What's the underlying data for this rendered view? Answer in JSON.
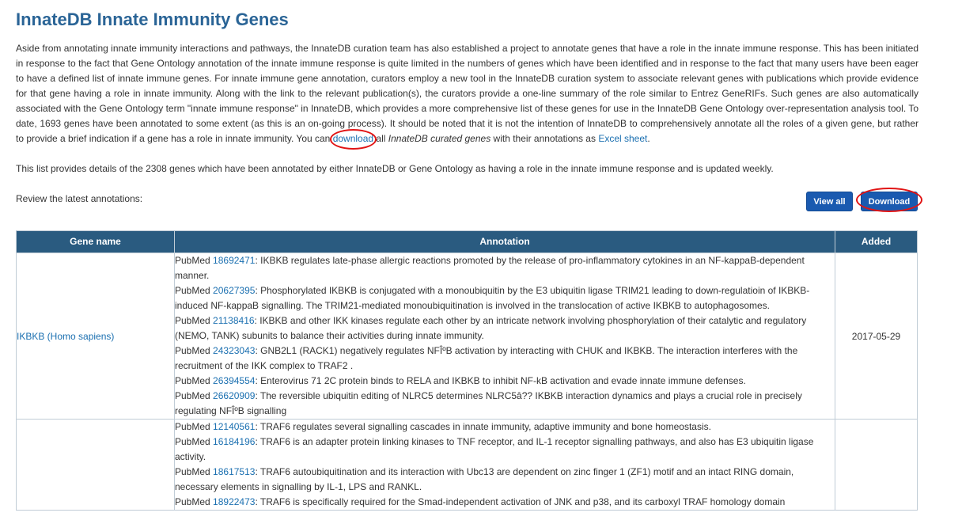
{
  "page": {
    "title": "InnateDB Innate Immunity Genes",
    "intro_before_download": "Aside from annotating innate immunity interactions and pathways, the InnateDB curation team has also established a project to annotate genes that have a role in the innate immune response. This has been initiated in response to the fact that Gene Ontology annotation of the innate immune response is quite limited in the numbers of genes which have been identified and in response to the fact that many users have been eager to have a defined list of innate immune genes. For innate immune gene annotation, curators employ a new tool in the InnateDB curation system to associate relevant genes with publications which provide evidence for that gene having a role in innate immunity. Along with the link to the relevant publication(s), the curators provide a one-line summary of the role similar to Entrez GeneRIFs. Such genes are also automatically associated with the Gene Ontology term \"innate immune response\" in InnateDB, which provides a more comprehensive list of these genes for use in the InnateDB Gene Ontology over-representation analysis tool. To date, 1693 genes have been annotated to some extent (as this is an on-going process). It should be noted that it is not the intention of InnateDB to comprehensively annotate all the roles of a given gene, but rather to provide a brief indication if a gene has a role in innate immunity. You can",
    "download_link": "download",
    "intro_after_download": "all",
    "curated_genes_italic": "InnateDB curated genes",
    "intro_with_annotations": "with their annotations as",
    "excel_link": "Excel sheet",
    "intro_period": ".",
    "list_details": "This list provides details of the 2308 genes which have been annotated by either InnateDB or Gene Ontology as having a role in the innate immune response and is updated weekly.",
    "review_label": "Review the latest annotations:"
  },
  "buttons": {
    "view_all": "View all",
    "download": "Download"
  },
  "colors": {
    "title": "#2a6496",
    "table_header": "#2a5b80",
    "button": "#1a5ab0",
    "link": "#1a6fb0",
    "highlight_ring": "#e11414"
  },
  "table": {
    "headers": [
      "Gene name",
      "Annotation",
      "Added"
    ],
    "rows": [
      {
        "gene": "IKBKB (Homo sapiens)",
        "added": "2017-05-29",
        "annotations": [
          {
            "prefix": "PubMed",
            "pmid": "18692471",
            "text": ": IKBKB regulates late-phase allergic reactions promoted by the release of pro-inflammatory cytokines in an NF-kappaB-dependent manner."
          },
          {
            "prefix": "PubMed",
            "pmid": "20627395",
            "text": ": Phosphorylated IKBKB is conjugated with a monoubiquitin by the E3 ubiquitin ligase TRIM21 leading to down-regulatioin of IKBKB-induced NF-kappaB signalling. The TRIM21-mediated monoubiquitination is involved in the translocation of active IKBKB to autophagosomes."
          },
          {
            "prefix": "PubMed",
            "pmid": "21138416",
            "text": ": IKBKB and other IKK kinases regulate each other by an intricate network involving phosphorylation of their catalytic and regulatory (NEMO, TANK) subunits to balance their activities during innate immunity."
          },
          {
            "prefix": "PubMed",
            "pmid": "24323043",
            "text": ": GNB2L1 (RACK1) negatively regulates NFÎºB activation by interacting with CHUK and IKBKB. The interaction interferes with the recruitment of the IKK complex to TRAF2 ."
          },
          {
            "prefix": "PubMed",
            "pmid": "26394554",
            "text": ": Enterovirus 71 2C protein binds to RELA and IKBKB to inhibit NF-kB activation and evade innate immune defenses."
          },
          {
            "prefix": "PubMed",
            "pmid": "26620909",
            "text": ": The reversible ubiquitin editing of NLRC5 determines NLRC5â?? IKBKB interaction dynamics and plays a crucial role in precisely regulating NFÎºB signalling"
          }
        ]
      },
      {
        "gene": "",
        "added": "",
        "annotations": [
          {
            "prefix": "PubMed",
            "pmid": "12140561",
            "text": ": TRAF6 regulates several signalling cascades in innate immunity, adaptive immunity and bone homeostasis."
          },
          {
            "prefix": "PubMed",
            "pmid": "16184196",
            "text": ": TRAF6 is an adapter protein linking kinases to TNF receptor, and IL-1 receptor signalling pathways, and also has E3 ubiquitin ligase activity."
          },
          {
            "prefix": "PubMed",
            "pmid": "18617513",
            "text": ": TRAF6 autoubiquitination and its interaction with Ubc13 are dependent on zinc finger 1 (ZF1) motif and an intact RING domain, necessary elements in signalling by IL-1, LPS and RANKL."
          },
          {
            "prefix": "PubMed",
            "pmid": "18922473",
            "text": ": TRAF6 is specifically required for the Smad-independent activation of JNK and p38, and its carboxyl TRAF homology domain"
          }
        ]
      }
    ]
  }
}
